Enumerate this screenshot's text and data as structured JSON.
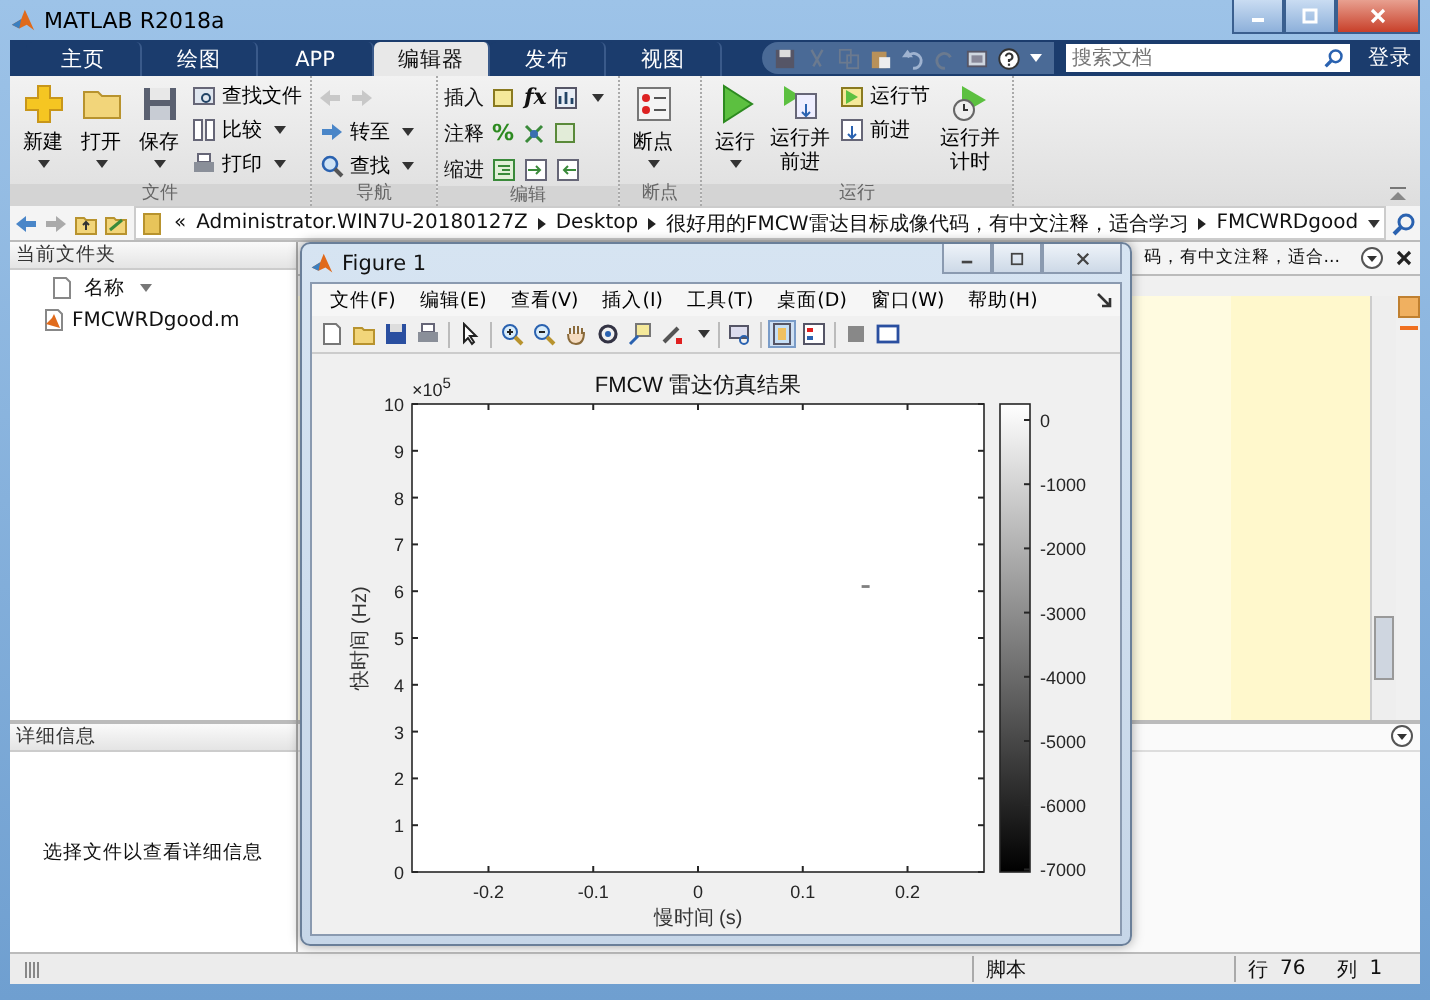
{
  "window": {
    "title": "MATLAB R2018a"
  },
  "tabs": [
    {
      "label": "主页",
      "selected": false
    },
    {
      "label": "绘图",
      "selected": false
    },
    {
      "label": "APP",
      "selected": false
    },
    {
      "label": "编辑器",
      "selected": true
    },
    {
      "label": "发布",
      "selected": false
    },
    {
      "label": "视图",
      "selected": false
    }
  ],
  "search": {
    "placeholder": "搜索文档"
  },
  "login": "登录",
  "ribbon": {
    "file": {
      "label": "文件",
      "new": "新建",
      "open": "打开",
      "save": "保存",
      "find_files": "查找文件",
      "compare": "比较",
      "print": "打印"
    },
    "navigate": {
      "label": "导航",
      "go_to": "转至",
      "find": "查找"
    },
    "edit": {
      "label": "编辑",
      "insert": "插入",
      "comment": "注释",
      "indent": "缩进",
      "fx": "fx",
      "percent": "%"
    },
    "breakpoints": {
      "label": "断点",
      "breakpoints": "断点"
    },
    "run": {
      "label": "运行",
      "run": "运行",
      "run_advance": "运行并前进",
      "run_section": "运行节",
      "advance": "前进",
      "run_time": "运行并计时"
    }
  },
  "address": {
    "overflow": "«",
    "segments": [
      "Administrator.WIN7U-20180127Z",
      "Desktop",
      "很好用的FMCW雷达目标成像代码，有中文注释，适合学习",
      "FMCWRDgood"
    ]
  },
  "current_folder": {
    "title": "当前文件夹",
    "column": "名称",
    "files": [
      "FMCWRDgood.m"
    ]
  },
  "details": {
    "title": "详细信息",
    "message": "选择文件以查看详细信息"
  },
  "editor": {
    "tab_title": "码，有中文注释，适合..."
  },
  "figure": {
    "title": "Figure 1",
    "menu": [
      "文件(F)",
      "编辑(E)",
      "查看(V)",
      "插入(I)",
      "工具(T)",
      "桌面(D)",
      "窗口(W)",
      "帮助(H)"
    ],
    "exponent": "×10$^{5}$",
    "chart_data": {
      "type": "scatter",
      "title": "FMCW 雷达仿真结果",
      "xlabel": "慢时间 (s)",
      "ylabel": "快时间 (Hz)",
      "x": [
        0.16
      ],
      "series": [
        {
          "color": "#808080",
          "values": [
            6.1
          ]
        }
      ],
      "xlim": [
        -0.273,
        0.273
      ],
      "ylim": [
        0,
        10
      ],
      "xticks": [
        -0.2,
        -0.1,
        0,
        0.1,
        0.2
      ],
      "yticks": [
        0,
        1,
        2,
        3,
        4,
        5,
        6,
        7,
        8,
        9,
        10
      ]
    },
    "colorbar": {
      "ticks": [
        "0",
        "-1000",
        "-2000",
        "-3000",
        "-4000",
        "-5000",
        "-6000",
        "-7000"
      ]
    }
  },
  "status_bar": {
    "mode": "脚本",
    "row_label": "行",
    "row": "76",
    "col_label": "列",
    "col": "1"
  }
}
